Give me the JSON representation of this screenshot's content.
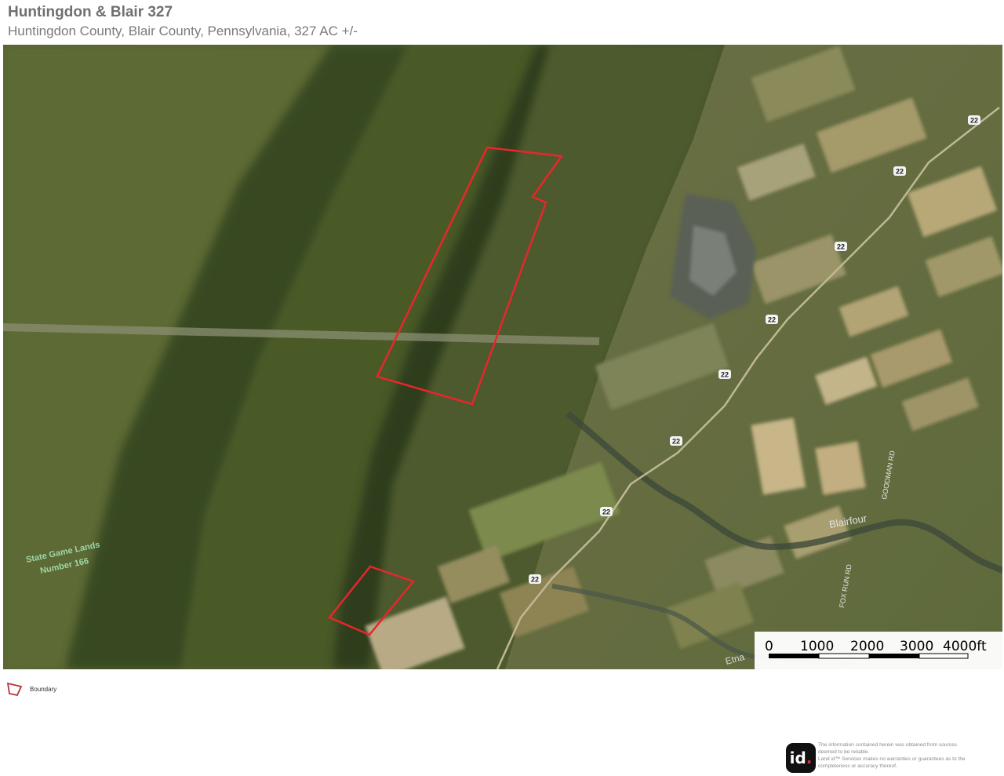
{
  "header": {
    "title": "Huntingdon & Blair 327",
    "subtitle": "Huntingdon County, Blair County, Pennsylvania, 327 AC +/-"
  },
  "map": {
    "type": "satellite",
    "boundary_color": "#e8262c",
    "labels": {
      "game_lands": [
        "State Game Lands",
        "Number 166"
      ],
      "village": "Blairfour",
      "roads": [
        "GOODMAN RD",
        "FOX RUN RD"
      ],
      "town": "Etna"
    },
    "route_shields": [
      "22",
      "22",
      "22",
      "22",
      "22",
      "22",
      "22"
    ],
    "scale_bar": {
      "ticks": [
        "0",
        "1000",
        "2000",
        "3000",
        "4000ft"
      ]
    }
  },
  "legend": {
    "label": "Boundary",
    "color": "#b5333c"
  },
  "footer": {
    "logo_text": "id",
    "logo_dot": ".",
    "disclaimer_lines": [
      "The information contained herein was obtained from sources",
      "deemed to be reliable.",
      "Land id™ Services makes no warranties or guarantees as to the",
      "completeness or accuracy thereof."
    ]
  }
}
